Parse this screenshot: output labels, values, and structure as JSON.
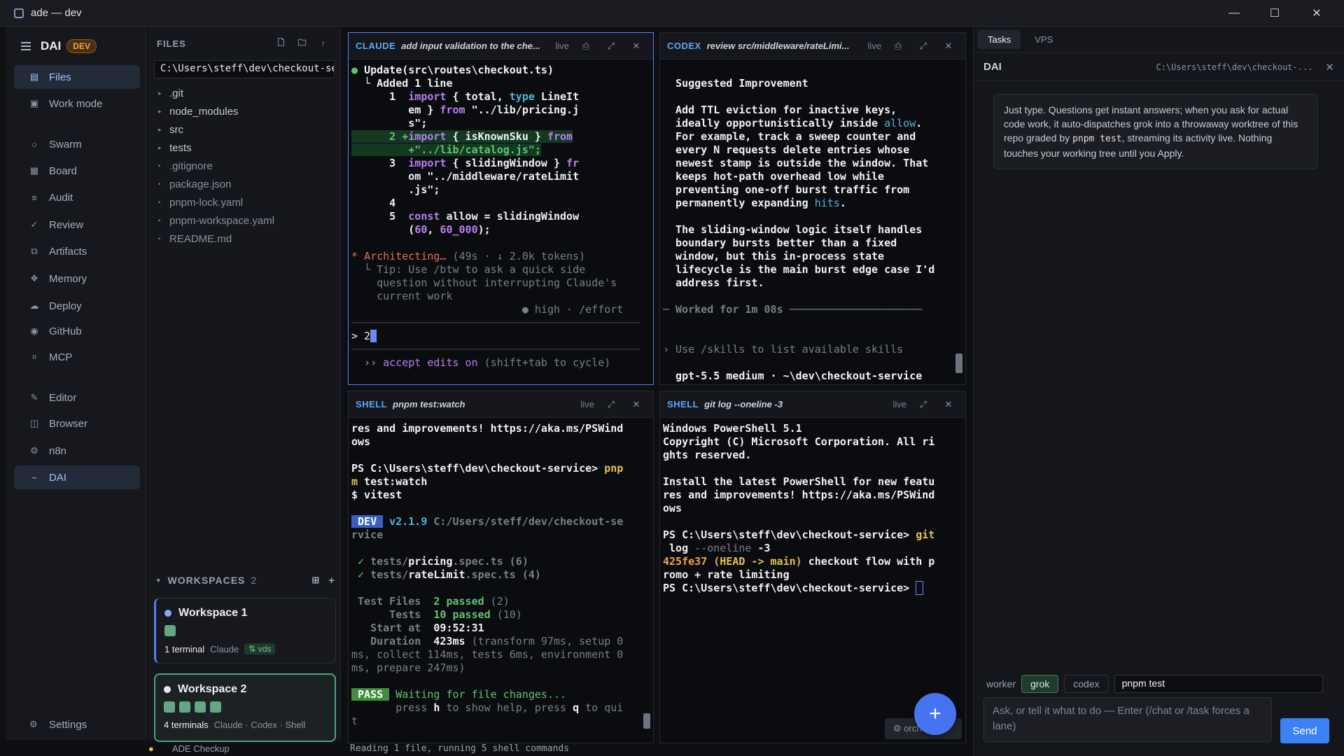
{
  "window": {
    "title": "ade — dev",
    "minimize": "—",
    "maximize": "☐",
    "close": "✕"
  },
  "sidebar": {
    "title": "DAI",
    "badge": "DEV",
    "items": [
      {
        "label": "Files",
        "icon": "▤"
      },
      {
        "label": "Work mode",
        "icon": "▣"
      },
      {
        "label": "Swarm",
        "icon": "○"
      },
      {
        "label": "Board",
        "icon": "▦"
      },
      {
        "label": "Audit",
        "icon": "≡"
      },
      {
        "label": "Review",
        "icon": "✓"
      },
      {
        "label": "Artifacts",
        "icon": "⧉"
      },
      {
        "label": "Memory",
        "icon": "❖"
      },
      {
        "label": "Deploy",
        "icon": "☁"
      },
      {
        "label": "GitHub",
        "icon": "◉"
      },
      {
        "label": "MCP",
        "icon": "⌗"
      },
      {
        "label": "Editor",
        "icon": "✎"
      },
      {
        "label": "Browser",
        "icon": "◫"
      },
      {
        "label": "n8n",
        "icon": "⚙"
      },
      {
        "label": "DAI",
        "icon": "~"
      }
    ],
    "settings": "Settings"
  },
  "files": {
    "title": "FILES",
    "path": "C:\\Users\\steff\\dev\\checkout-se",
    "folders": [
      ".git",
      "node_modules",
      "src",
      "tests"
    ],
    "files": [
      ".gitignore",
      "package.json",
      "pnpm-lock.yaml",
      "pnpm-workspace.yaml",
      "README.md"
    ]
  },
  "workspaces": {
    "title": "WORKSPACES",
    "count": "2",
    "items": [
      {
        "name": "Workspace 1",
        "terminals": "1 terminal",
        "agents": "Claude",
        "tag": "⇅ vds"
      },
      {
        "name": "Workspace 2",
        "terminals": "4 terminals",
        "agents": "Claude · Codex · Shell"
      }
    ]
  },
  "panes": {
    "claude": {
      "kind": "CLAUDE",
      "subtitle": "add input validation to the che...",
      "live": "live",
      "icons": [
        "⎙",
        "⤢",
        "✕"
      ],
      "lines": {
        "l1": "Update(src\\routes\\checkout.ts)",
        "l2": "  └ Added 1 line",
        "l3a": "      1  ",
        "l3b": "import",
        "l3c": " { total, ",
        "l3d": "type",
        "l3e": " LineIt",
        "l4": "         em } ",
        "l4b": "from",
        "l4c": " \"../lib/pricing.j",
        "l5": "         s\";",
        "l6a": "      2 +",
        "l6b": "import",
        "l6c": " { isKnownSku } ",
        "l6d": "from",
        "l7": "         +\"../lib/catalog.js\";",
        "l8a": "      3  ",
        "l8b": "import",
        "l8c": " { slidingWindow } ",
        "l8d": "fr",
        "l9": "         om \"../middleware/rateLimit",
        "l10": "         .js\";",
        "l11": "      4",
        "l12a": "      5  ",
        "l12b": "const",
        "l12c": " allow = slidingWindow",
        "l13a": "         (",
        "l13b": "60",
        "l13c": ", ",
        "l13d": "60_000",
        "l13e": ");",
        "l14a": "* Architecting…",
        "l14b": " (49s · ↓ 2.0k tokens)",
        "l15": "  └ Tip: Use /btw to ask a quick side",
        "l16": "    question without interrupting Claude's",
        "l17": "    current work",
        "l18": "                           ● high · /effort",
        "l19": "> 2",
        "l20": "  ›› accept edits on",
        "l20b": " (shift+tab to cycle)"
      }
    },
    "codex": {
      "kind": "CODEX",
      "subtitle": "review src/middleware/rateLimi...",
      "live": "live",
      "icons": [
        "⎙",
        "⤢",
        "✕"
      ],
      "lines": {
        "l1": "  Suggested Improvement",
        "l2": "  Add TTL eviction for inactive keys,",
        "l3a": "  ideally opportunistically inside ",
        "l3b": "allow",
        "l3c": ".",
        "l4": "  For example, track a sweep counter and",
        "l5": "  every N requests delete entries whose",
        "l6": "  newest stamp is outside the window. That",
        "l7": "  keeps hot-path overhead low while",
        "l8": "  preventing one-off burst traffic from",
        "l9a": "  permanently expanding ",
        "l9b": "hits",
        "l9c": ".",
        "l10": "  The sliding-window logic itself handles",
        "l11": "  boundary bursts better than a fixed",
        "l12": "  window, but this in-process state",
        "l13": "  lifecycle is the main burst edge case I'd",
        "l14": "  address first.",
        "l15": "─ Worked for 1m 08s ─────────────────────",
        "l16": "› Use /skills to list available skills",
        "l17": "  gpt-5.5 medium · ~\\dev\\checkout-service"
      }
    },
    "shell1": {
      "kind": "SHELL",
      "subtitle": "pnpm test:watch",
      "live": "live",
      "icons": [
        "⤢",
        "✕"
      ],
      "lines": {
        "l1": "res and improvements! https://aka.ms/PSWind",
        "l2": "ows",
        "l3a": "PS C:\\Users\\steff\\dev\\checkout-service> ",
        "l3b": "pnp",
        "l4a": "m",
        "l4b": " test:watch",
        "l5": "$ vitest",
        "l6a": " DEV ",
        "l6b": " v2.1.9 ",
        "l6c": "C:/Users/steff/dev/checkout-se",
        "l7": "rvice",
        "l8a": " ✓ ",
        "l8b": "tests/",
        "l8c": "pricing",
        "l8d": ".spec.ts (6)",
        "l9a": " ✓ ",
        "l9b": "tests/",
        "l9c": "rateLimit",
        "l9d": ".spec.ts (4)",
        "l10a": " Test Files  ",
        "l10b": "2 passed",
        "l10c": " (2)",
        "l11a": "      Tests  ",
        "l11b": "10 passed",
        "l11c": " (10)",
        "l12a": "   Start at  ",
        "l12b": "09:52:31",
        "l13a": "   Duration  ",
        "l13b": "423ms",
        "l13c": " (transform 97ms, setup 0",
        "l14": "ms, collect 114ms, tests 6ms, environment 0",
        "l15": "ms, prepare 247ms)",
        "l16a": " PASS ",
        "l16b": " Waiting for file changes...",
        "l17a": "       press ",
        "l17b": "h",
        "l17c": " to show help, press ",
        "l17d": "q",
        "l17e": " to qui",
        "l18": "t"
      }
    },
    "shell2": {
      "kind": "SHELL",
      "subtitle": "git log --oneline -3",
      "live": "live",
      "icons": [
        "⤢",
        "✕"
      ],
      "lines": {
        "l1": "Windows PowerShell 5.1",
        "l2": "Copyright (C) Microsoft Corporation. All ri",
        "l3": "ghts reserved.",
        "l4": "Install the latest PowerShell for new featu",
        "l5": "res and improvements! https://aka.ms/PSWind",
        "l6": "ows",
        "l7a": "PS C:\\Users\\steff\\dev\\checkout-service> ",
        "l7b": "git",
        "l8a": " log ",
        "l8b": "--oneline",
        "l8c": " -3",
        "l9a": "425fe37",
        "l9b": " (",
        "l9c": "HEAD -> main",
        "l9d": ")",
        "l9e": " checkout flow with p",
        "l10": "romo + rate limiting",
        "l11": "PS C:\\Users\\steff\\dev\\checkout-service> "
      }
    }
  },
  "fab": "+",
  "orch": "⚙ orch",
  "right": {
    "tabs": [
      "Tasks",
      "VPS"
    ],
    "title": "DAI",
    "path": "C:\\Users\\steff\\dev\\checkout-...",
    "close": "✕",
    "hint_a": "Just type. Questions get instant answers; when you ask for actual code work, it auto-dispatches grok into a throwaway worktree of this repo graded by ",
    "hint_code": "pnpm test",
    "hint_b": ", streaming its activity live. Nothing touches your working tree until you Apply.",
    "worker_label": "worker",
    "workers": [
      "grok",
      "codex"
    ],
    "worker_cmd": "pnpm test",
    "ask_placeholder": "Ask, or tell it what to do — Enter (/chat or /task forces a lane)",
    "send": "Send"
  },
  "bottom": {
    "left": "ADE Checkup",
    "right": "Reading 1 file, running 5 shell commands"
  }
}
